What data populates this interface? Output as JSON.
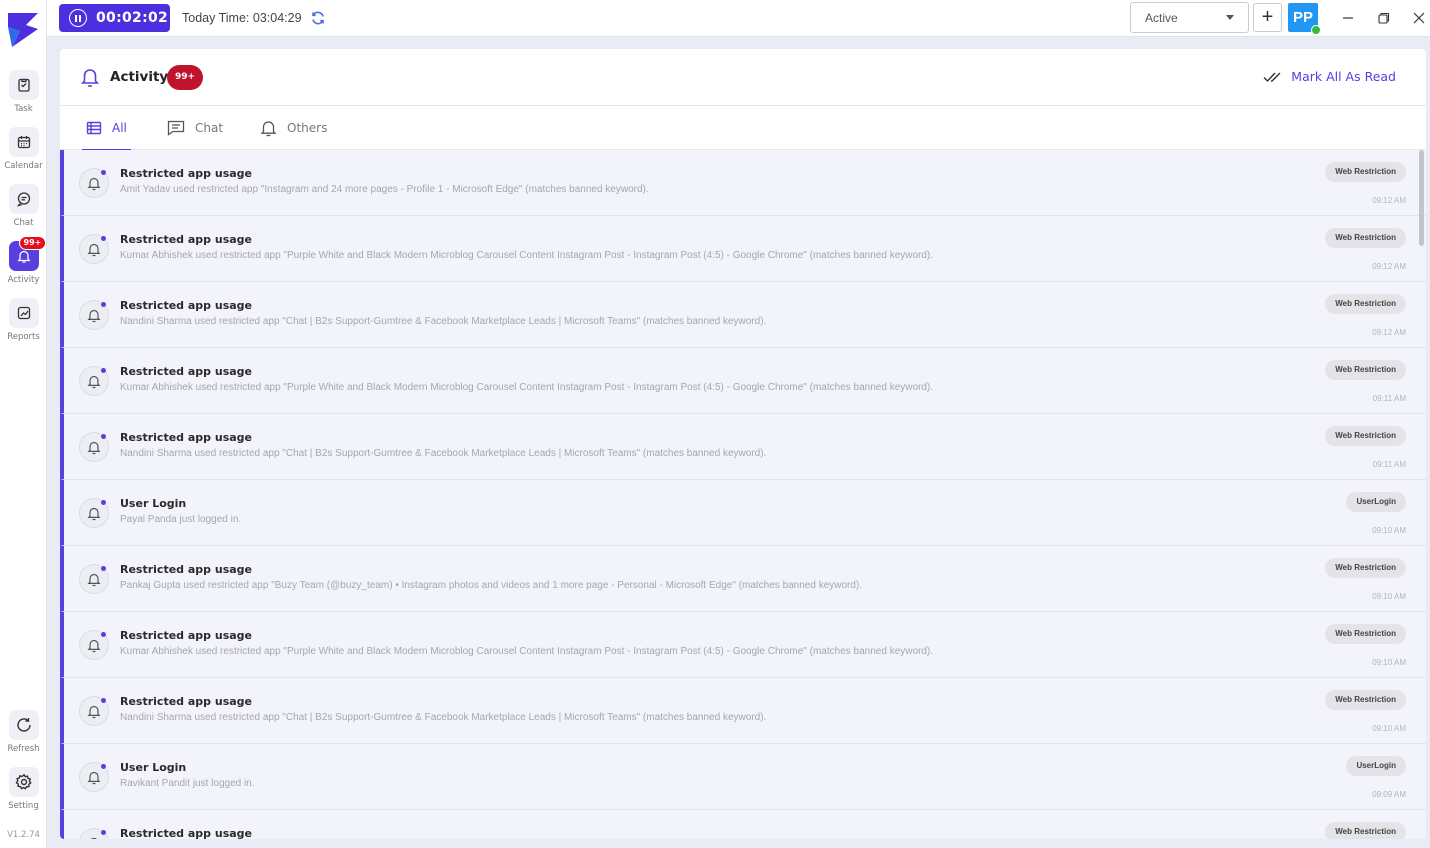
{
  "app": {
    "version": "V1.2.74",
    "brand_color": "#5b3ee0"
  },
  "sidebar": {
    "items": [
      {
        "label": "Task",
        "icon": "task-icon"
      },
      {
        "label": "Calendar",
        "icon": "calendar-icon"
      },
      {
        "label": "Chat",
        "icon": "chat-icon"
      },
      {
        "label": "Activity",
        "icon": "bell-icon",
        "badge": "99+",
        "active": true
      },
      {
        "label": "Reports",
        "icon": "reports-icon"
      }
    ],
    "bottom_items": [
      {
        "label": "Refresh",
        "icon": "refresh-icon"
      },
      {
        "label": "Setting",
        "icon": "gear-icon"
      }
    ]
  },
  "topbar": {
    "timer": "00:02:02",
    "today_time": "Today Time: 03:04:29",
    "status": "Active",
    "avatar_initials": "PP"
  },
  "activity": {
    "title": "Activity",
    "badge": "99+",
    "mark_all_read": "Mark All As Read",
    "tabs": [
      {
        "label": "All",
        "icon": "list-icon",
        "active": true
      },
      {
        "label": "Chat",
        "icon": "chat-icon"
      },
      {
        "label": "Others",
        "icon": "bell-icon"
      }
    ],
    "notifications": [
      {
        "title": "Restricted app usage",
        "desc": "Amit Yadav used restricted app \"Instagram and 24 more pages - Profile 1 - Microsoft Edge\" (matches banned keyword).",
        "tag": "Web Restriction",
        "time": "09:12 AM"
      },
      {
        "title": "Restricted app usage",
        "desc": "Kumar Abhishek used restricted app \"Purple White and Black Modern Microblog Carousel Content Instagram Post - Instagram Post (4:5) - Google Chrome\" (matches banned keyword).",
        "tag": "Web Restriction",
        "time": "09:12 AM"
      },
      {
        "title": "Restricted app usage",
        "desc": "Nandini Sharma used restricted app \"Chat | B2s Support-Gumtree & Facebook Marketplace Leads | Microsoft Teams\" (matches banned keyword).",
        "tag": "Web Restriction",
        "time": "09:12 AM"
      },
      {
        "title": "Restricted app usage",
        "desc": "Kumar Abhishek used restricted app \"Purple White and Black Modern Microblog Carousel Content Instagram Post - Instagram Post (4:5) - Google Chrome\" (matches banned keyword).",
        "tag": "Web Restriction",
        "time": "09:11 AM"
      },
      {
        "title": "Restricted app usage",
        "desc": "Nandini Sharma used restricted app \"Chat | B2s Support-Gumtree & Facebook Marketplace Leads | Microsoft Teams\" (matches banned keyword).",
        "tag": "Web Restriction",
        "time": "09:11 AM"
      },
      {
        "title": "User Login",
        "desc": "Payal Panda just logged in.",
        "tag": "UserLogin",
        "time": "09:10 AM"
      },
      {
        "title": "Restricted app usage",
        "desc": "Pankaj Gupta used restricted app \"Buzy Team (@buzy_team) • Instagram photos and videos and 1 more page - Personal - Microsoft Edge\" (matches banned keyword).",
        "tag": "Web Restriction",
        "time": "09:10 AM"
      },
      {
        "title": "Restricted app usage",
        "desc": "Kumar Abhishek used restricted app \"Purple White and Black Modern Microblog Carousel Content Instagram Post - Instagram Post (4:5) - Google Chrome\" (matches banned keyword).",
        "tag": "Web Restriction",
        "time": "09:10 AM"
      },
      {
        "title": "Restricted app usage",
        "desc": "Nandini Sharma used restricted app \"Chat | B2s Support-Gumtree & Facebook Marketplace Leads | Microsoft Teams\" (matches banned keyword).",
        "tag": "Web Restriction",
        "time": "09:10 AM"
      },
      {
        "title": "User Login",
        "desc": "Ravikant Pandit just logged in.",
        "tag": "UserLogin",
        "time": "09:09 AM"
      },
      {
        "title": "Restricted app usage",
        "desc": "",
        "tag": "Web Restriction",
        "time": ""
      }
    ]
  }
}
